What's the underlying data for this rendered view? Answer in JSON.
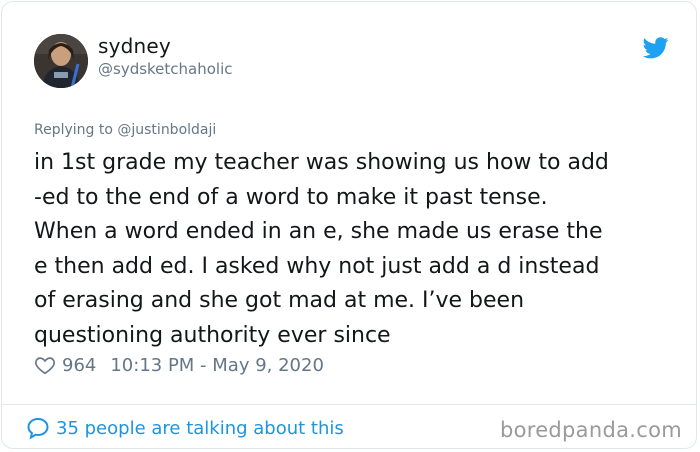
{
  "user": {
    "display_name": "sydney",
    "handle": "@sydsketchaholic",
    "avatar_icon": "user-avatar-photo"
  },
  "platform_icon": "twitter-bird-icon",
  "accent_color": "#1da1f2",
  "replying_to": "Replying to @justinboldaji",
  "tweet": {
    "text": "in 1st grade my teacher was showing us how to add\n-ed to the end of a word to make it past tense.\nWhen a word ended in an e, she made us erase the\ne then add ed. I asked why not just add a d instead\nof erasing and she got mad at me. I’ve been\nquestioning authority ever since",
    "likes": "964",
    "timestamp": "10:13 PM - May 9, 2020"
  },
  "footer": {
    "conversation_label": "35 people are talking about this",
    "watermark": "boredpanda.com"
  }
}
